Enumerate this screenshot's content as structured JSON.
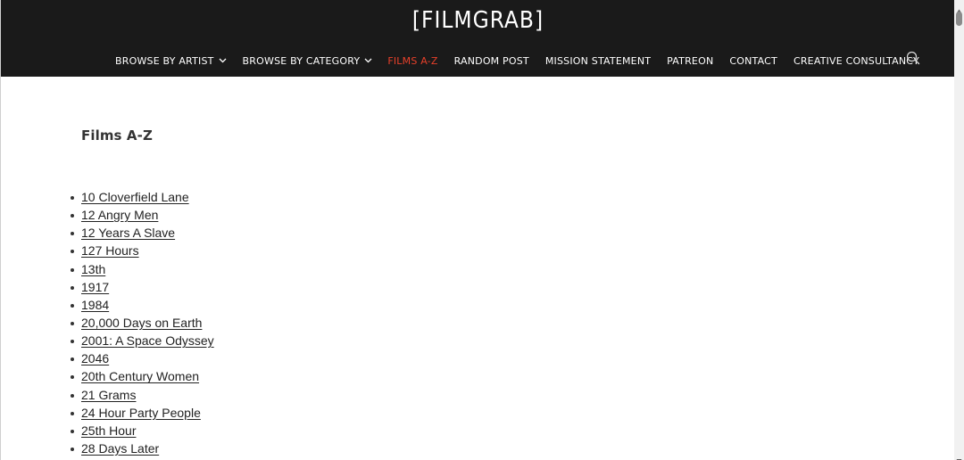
{
  "header": {
    "site_title": "[FILMGRAB]",
    "nav": [
      {
        "label": "BROWSE BY ARTIST",
        "dropdown": true,
        "active": false
      },
      {
        "label": "BROWSE BY CATEGORY",
        "dropdown": true,
        "active": false
      },
      {
        "label": "FILMS A-Z",
        "dropdown": false,
        "active": true
      },
      {
        "label": "RANDOM POST",
        "dropdown": false,
        "active": false
      },
      {
        "label": "MISSION STATEMENT",
        "dropdown": false,
        "active": false
      },
      {
        "label": "PATREON",
        "dropdown": false,
        "active": false
      },
      {
        "label": "CONTACT",
        "dropdown": false,
        "active": false
      },
      {
        "label": "CREATIVE CONSULTANCY",
        "dropdown": false,
        "active": false
      }
    ],
    "search_icon": "search-icon",
    "colors": {
      "background": "#1a1a1a",
      "text": "#ffffff",
      "active": "#e8402a"
    }
  },
  "main": {
    "page_title": "Films A-Z",
    "films": [
      "10 Cloverfield Lane",
      "12 Angry Men",
      "12 Years A Slave",
      "127 Hours",
      "13th",
      "1917",
      "1984",
      "20,000 Days on Earth",
      "2001: A Space Odyssey",
      "2046",
      "20th Century Women",
      "21 Grams",
      "24 Hour Party People",
      "25th Hour",
      "28 Days Later"
    ]
  }
}
